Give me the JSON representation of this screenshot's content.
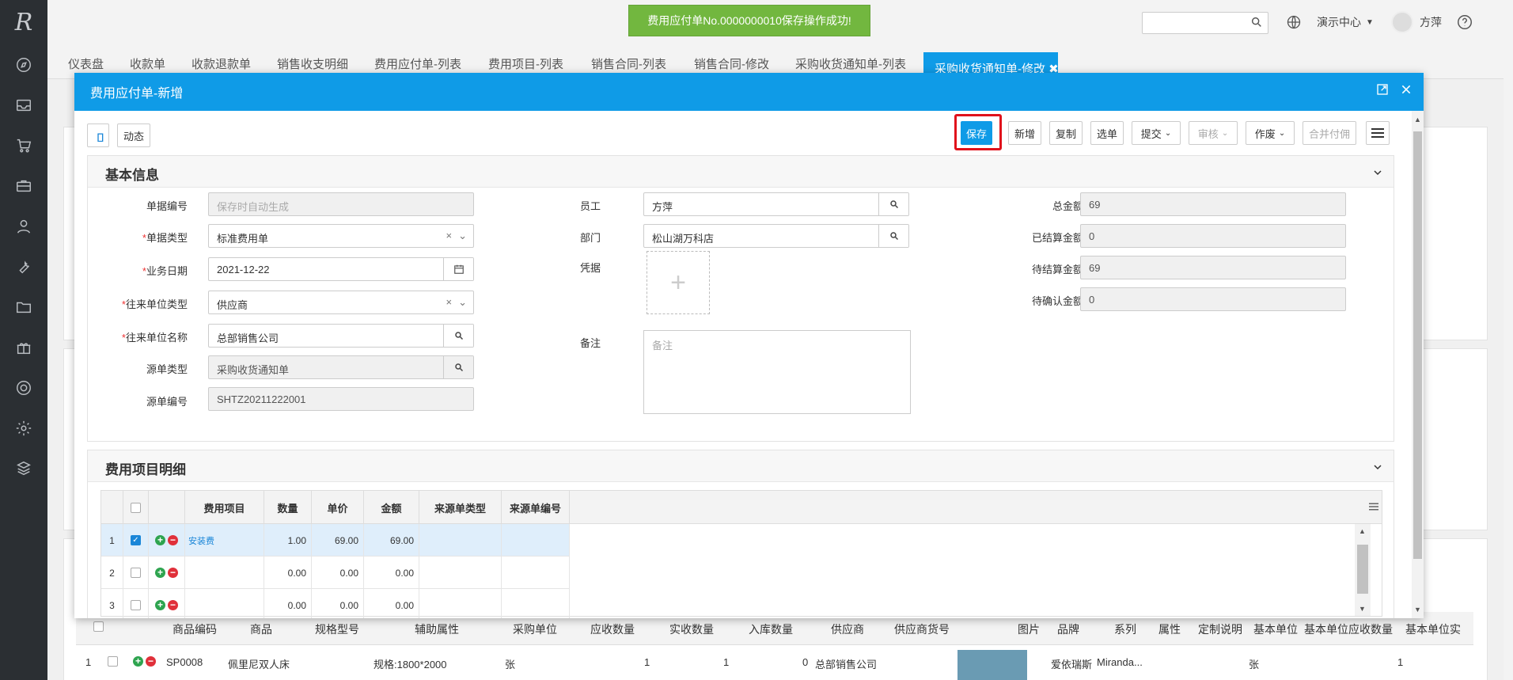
{
  "toast": "费用应付单No.0000000010保存操作成功!",
  "top": {
    "center": "演示中心",
    "user": "方萍",
    "logo": "R"
  },
  "tabs": [
    "仪表盘",
    "收款单",
    "收款退款单",
    "销售收支明细",
    "费用应付单-列表",
    "费用项目-列表",
    "销售合同-列表",
    "销售合同-修改",
    "采购收货通知单-列表"
  ],
  "active_tab": "采购收货通知单-修改",
  "sidebar_icons": [
    "compass-icon",
    "inbox-icon",
    "cart-icon",
    "briefcase-icon",
    "user-icon",
    "wrench-icon",
    "folder-icon",
    "gift-icon",
    "support-icon",
    "gear-icon",
    "cube-icon"
  ],
  "modal": {
    "title": "费用应付单-新增",
    "toolbar": {
      "dynamic": "动态",
      "save": "保存",
      "new": "新增",
      "copy": "复制",
      "pick": "选单",
      "submit": "提交",
      "audit": "审核",
      "void": "作废",
      "merge_pay": "合并付佣"
    },
    "basic": {
      "title": "基本信息",
      "doc_no_label": "单据编号",
      "doc_no_placeholder": "保存时自动生成",
      "doc_type_label": "单据类型",
      "doc_type_value": "标准费用单",
      "biz_date_label": "业务日期",
      "biz_date_value": "2021-12-22",
      "party_type_label": "往来单位类型",
      "party_type_value": "供应商",
      "party_name_label": "往来单位名称",
      "party_name_value": "总部销售公司",
      "src_type_label": "源单类型",
      "src_type_value": "采购收货通知单",
      "src_no_label": "源单编号",
      "src_no_value": "SHTZ20211222001",
      "employee_label": "员工",
      "employee_value": "方萍",
      "dept_label": "部门",
      "dept_value": "松山湖万科店",
      "voucher_label": "凭据",
      "remark_label": "备注",
      "remark_placeholder": "备注",
      "total_label": "总金额",
      "total_value": "69",
      "settled_label": "已结算金额",
      "settled_value": "0",
      "pending_label": "待结算金额",
      "pending_value": "69",
      "unconfirmed_label": "待确认金额",
      "unconfirmed_value": "0"
    },
    "detail": {
      "title": "费用项目明细",
      "columns": [
        "费用项目",
        "数量",
        "单价",
        "金额",
        "来源单类型",
        "来源单编号"
      ],
      "rows": [
        {
          "no": "1",
          "item": "安装费",
          "qty": "1.00",
          "price": "69.00",
          "amount": "69.00",
          "checked": true
        },
        {
          "no": "2",
          "item": "",
          "qty": "0.00",
          "price": "0.00",
          "amount": "0.00",
          "checked": false
        },
        {
          "no": "3",
          "item": "",
          "qty": "0.00",
          "price": "0.00",
          "amount": "0.00",
          "checked": false
        }
      ]
    }
  },
  "under_grid": {
    "columns": [
      "商品编码",
      "商品",
      "规格型号",
      "辅助属性",
      "采购单位",
      "应收数量",
      "实收数量",
      "入库数量",
      "供应商",
      "供应商货号",
      "图片",
      "品牌",
      "系列",
      "属性",
      "定制说明",
      "基本单位",
      "基本单位应收数量",
      "基本单位实"
    ],
    "row": {
      "no": "1",
      "code": "SP0008",
      "name": "佩里尼双人床",
      "aux": "规格:1800*2000",
      "unit": "张",
      "due": "1",
      "got": "1",
      "stock": "0",
      "supplier": "总部销售公司",
      "brand": "爱依瑞斯",
      "series": "Miranda...",
      "base_unit": "张",
      "base_due": "1"
    }
  },
  "colors": {
    "accent": "#0f9be7",
    "toast": "#72b73f",
    "sidebar": "#2b2f33",
    "highlight": "#e0111b"
  }
}
